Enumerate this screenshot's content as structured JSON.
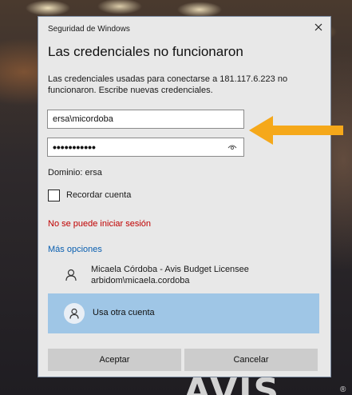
{
  "dialog": {
    "caption": "Seguridad de Windows",
    "heading": "Las credenciales no funcionaron",
    "description": "Las credenciales usadas para conectarse a 181.117.6.223 no funcionaron. Escribe nuevas credenciales.",
    "username_value": "ersa\\micordoba",
    "password_mask": "•••••••••••",
    "domain_text": "Dominio: ersa",
    "remember_label": "Recordar cuenta",
    "remember_checked": false,
    "error_text": "No se puede iniciar sesión",
    "more_options": "Más opciones",
    "account": {
      "name": "Micaela Córdoba - Avis Budget Licensee",
      "login": "arbidom\\micaela.cordoba"
    },
    "other_account_label": "Usa otra cuenta",
    "ok_label": "Aceptar",
    "cancel_label": "Cancelar"
  },
  "background": {
    "brand_text": "AVIS",
    "brand_mark": "®"
  },
  "colors": {
    "dialog_bg": "#e8e8e8",
    "error": "#c00000",
    "link": "#0a5fb0",
    "selected_row": "#9fc6e6",
    "arrow": "#f5a81a"
  },
  "icons": [
    "close-icon",
    "eye-icon",
    "person-icon",
    "arrow-icon"
  ]
}
